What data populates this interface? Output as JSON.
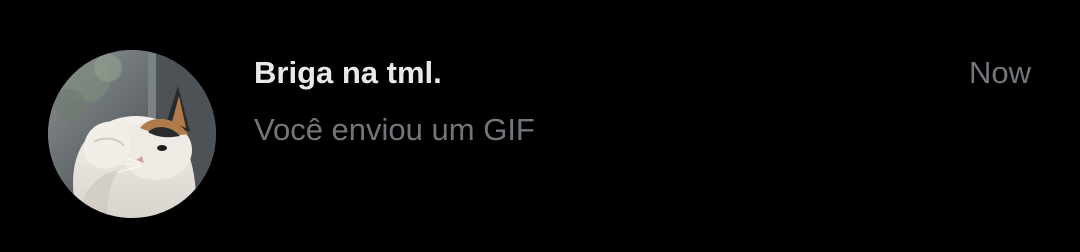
{
  "conversation": {
    "name": "Briga na tml.",
    "timestamp": "Now",
    "last_message": "Você enviou um GIF",
    "avatar": {
      "icon": "cat-photo-avatar",
      "description_colors": [
        "#6a6f72",
        "#f2efe9",
        "#b07a4a",
        "#2b2a2a"
      ]
    }
  },
  "colors": {
    "background": "#000000",
    "primary_text": "#e7e9ea",
    "secondary_text": "#71767b"
  }
}
